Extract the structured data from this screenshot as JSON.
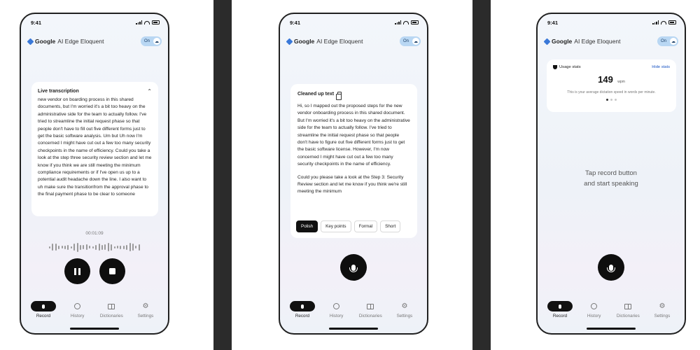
{
  "status_time": "9:41",
  "app": {
    "brand_google": "Google",
    "brand_rest": "AI Edge Eloquent",
    "toggle_label": "On"
  },
  "screen1": {
    "card_title": "Live transcription",
    "transcription": "new vendor on boarding process in this shared documents, but I'm worried it's a bit too heavy on the administrative side for the team to actually follow. I've tried to streamline the initial request phase so that people don't have to fill out five different forms just to get the basic software analysis. Um but Uh now I'm concerned I might have cut out a few too many security checkpoints in the name of efficiency. Could you take a look at the step three security review section and let me know if you think we are still meeting the minimum compliance requirements or if I've open us up to a potential audit headache down the line. I also want to uh make sure the transitionfrom the approval phase to the final payment phase to be clear to someone",
    "timer": "00:01:09"
  },
  "screen2": {
    "card_title": "Cleaned up text",
    "paragraph1": "Hi, so I mapped out the proposed steps for the new vendor onboarding process in this shared document. But I'm worried it's a bit too heavy on the administrative side for the team to actually follow. I've tried to streamline the initial request phase so that people don't have to figure out five different forms just to get the basic software license. However, I'm now concerned I might have cut out a few too many security checkpoints in the name of efficiency.",
    "paragraph2": "Could you please take a look at the Step 3: Security Review section and let me know if you think we're still meeting the minimum",
    "chips": [
      "Polish",
      "Key points",
      "Formal",
      "Short"
    ]
  },
  "screen3": {
    "usage_label": "Usage stats",
    "hide_label": "Hide stats",
    "wpm_value": "149",
    "wpm_unit": "wpm",
    "wpm_desc": "This is your average dictation speed in words per minute.",
    "prompt_line1": "Tap record button",
    "prompt_line2": "and start speaking"
  },
  "nav": [
    "Record",
    "History",
    "Dictionaries",
    "Settings"
  ],
  "colors": {
    "accent": "#111111",
    "link": "#1a55c4",
    "toggle_bg": "#b9d7f3"
  }
}
